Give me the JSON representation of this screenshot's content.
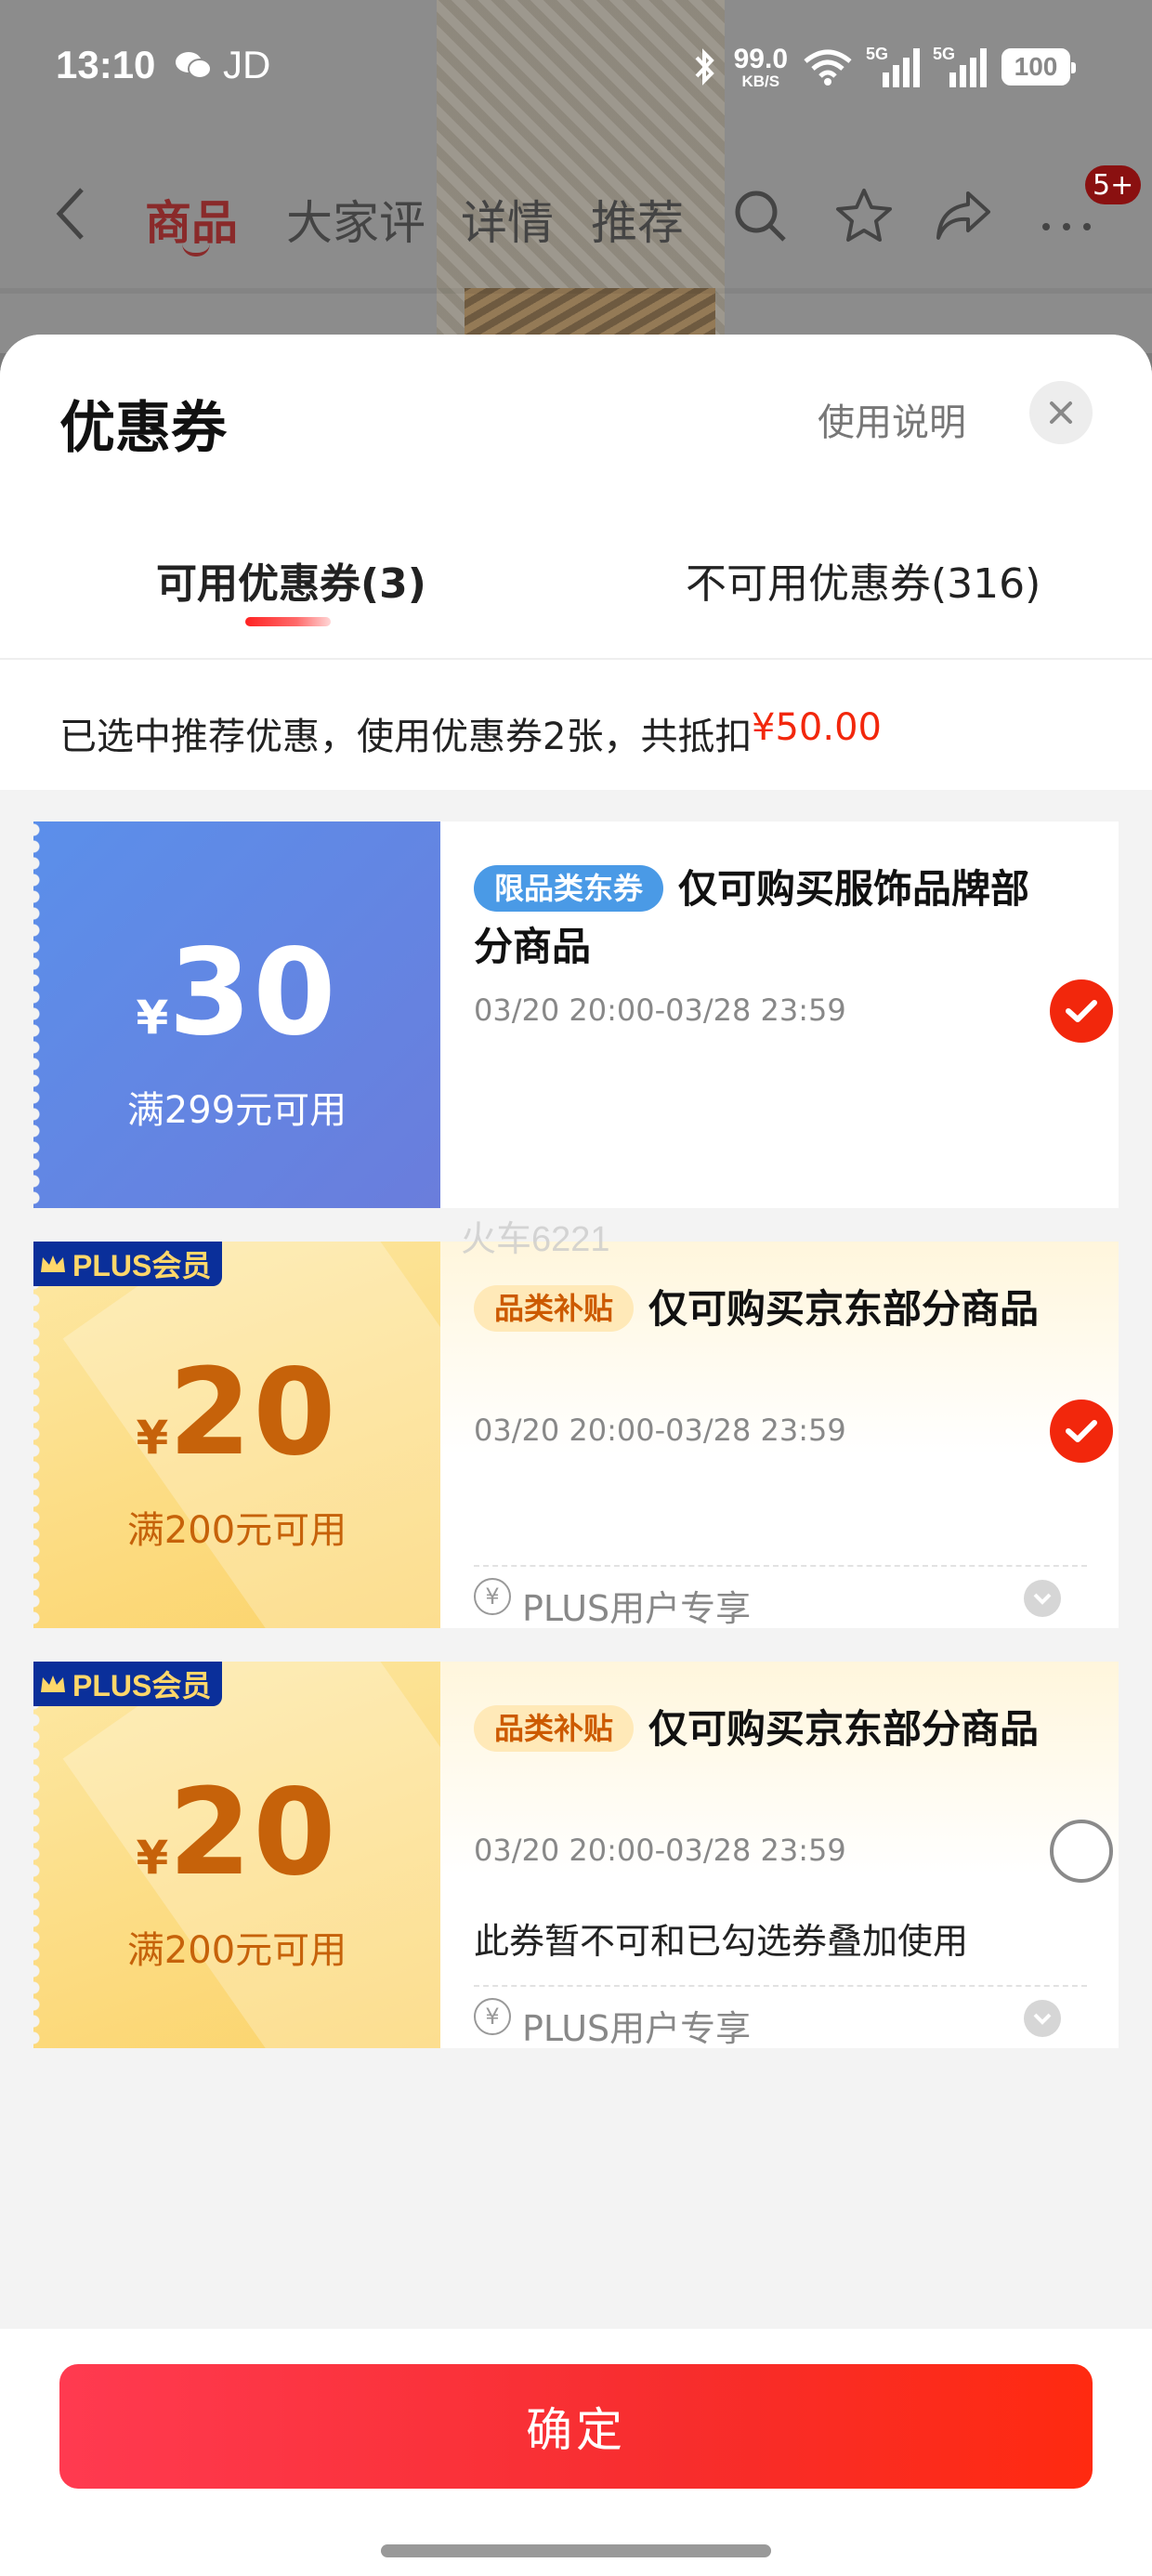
{
  "status_bar": {
    "time": "13:10",
    "app_label": "JD",
    "net_speed_value": "99.0",
    "net_speed_unit": "KB/S",
    "signal_1_label": "5G",
    "signal_2_label": "5G",
    "battery": "100"
  },
  "background_nav": {
    "tabs": [
      "商品",
      "大家评",
      "详情",
      "推荐"
    ],
    "active_tab": 0,
    "cart_badge": "5+"
  },
  "sheet": {
    "title": "优惠券",
    "help_link": "使用说明",
    "tabs": [
      {
        "label": "可用优惠券(3)",
        "active": true
      },
      {
        "label": "不可用优惠券(316)",
        "active": false
      }
    ],
    "summary_text": "已选中推荐优惠，使用优惠券2张，共抵扣",
    "summary_amount": "¥50.00"
  },
  "coupons": [
    {
      "style": "blue",
      "currency": "¥",
      "amount": "30",
      "condition": "满299元可用",
      "tag": "限品类东券",
      "title": "仅可购买服饰品牌部分商品",
      "validity": "03/20 20:00-03/28 23:59",
      "selected": true,
      "plus_badge": "",
      "note": "",
      "footer": ""
    },
    {
      "style": "gold",
      "currency": "¥",
      "amount": "20",
      "condition": "满200元可用",
      "tag": "品类补贴",
      "title": "仅可购买京东部分商品",
      "validity": "03/20 20:00-03/28 23:59",
      "selected": true,
      "plus_badge": "PLUS会员",
      "note": "",
      "footer": "PLUS用户专享"
    },
    {
      "style": "gold",
      "currency": "¥",
      "amount": "20",
      "condition": "满200元可用",
      "tag": "品类补贴",
      "title": "仅可购买京东部分商品",
      "validity": "03/20 20:00-03/28 23:59",
      "selected": false,
      "plus_badge": "PLUS会员",
      "note": "此券暂不可和已勾选券叠加使用",
      "footer": "PLUS用户专享"
    }
  ],
  "watermark": "火车6221",
  "confirm_label": "确定",
  "colors": {
    "accent_red": "#f2270c",
    "coupon_blue": "#5b8fea",
    "coupon_gold": "#fbd36a",
    "plus_navy": "#0a2f9a"
  },
  "icons": [
    "wechat-icon",
    "bluetooth-icon",
    "wifi-icon",
    "back-arrow-icon",
    "search-icon",
    "star-icon",
    "share-icon",
    "more-icon",
    "close-icon",
    "check-icon",
    "crown-icon",
    "yen-icon",
    "chevron-down-icon"
  ]
}
